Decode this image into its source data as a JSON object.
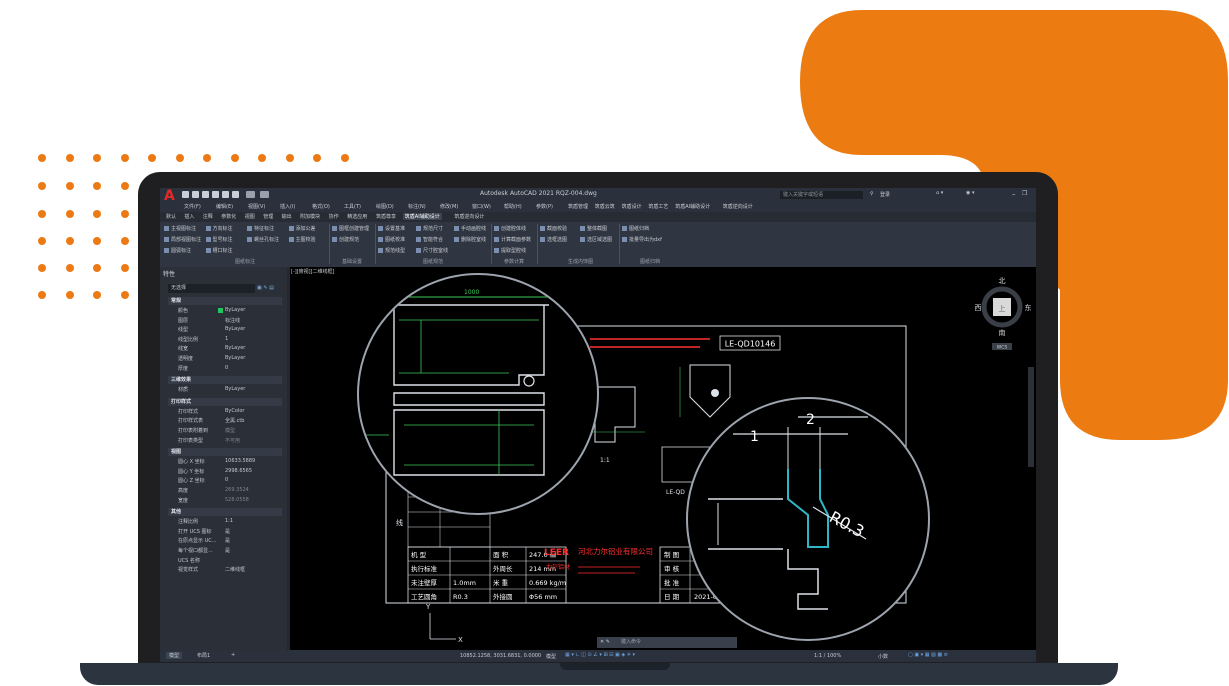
{
  "colors": {
    "accent": "#ec7a14",
    "laptop": "#1f1f22",
    "screen_bg": "#232831",
    "drawing_bg": "#000000",
    "line_white": "#dde2e8",
    "line_green": "#3ec85a",
    "line_red": "#ff3030",
    "line_cyan": "#2fb6c6"
  },
  "app": {
    "title": "Autodesk AutoCAD 2021   RQZ-004.dwg",
    "search_placeholder": "键入关键字或短语",
    "login_label": "登录",
    "quick_access_icons": [
      "new-icon",
      "open-icon",
      "save-icon",
      "saveas-icon",
      "print-icon",
      "plot-icon",
      "undo-icon",
      "redo-icon"
    ]
  },
  "menu": [
    "文件(F)",
    "编辑(E)",
    "视图(V)",
    "插入(I)",
    "格式(O)",
    "工具(T)",
    "绘图(D)",
    "标注(N)",
    "修改(M)",
    "窗口(W)",
    "帮助(H)",
    "参数(P)",
    "筑盾管理",
    "筑盾云筑",
    "筑盾设计",
    "筑盾工艺",
    "筑盾AI辅助设计",
    "筑盾逆向设计"
  ],
  "tabs": [
    "默认",
    "插入",
    "注释",
    "参数化",
    "视图",
    "管理",
    "输出",
    "附加模块",
    "协作",
    "精选应用",
    "筑盾尊享",
    "筑盾AI辅助设计",
    "筑盾逆向设计"
  ],
  "active_tab": "筑盾AI辅助设计",
  "ribbon": {
    "groups": [
      {
        "name": "图纸标注",
        "items": [
          "主视图标注",
          "方向标注",
          "特征标注",
          "添加公差",
          "局部视图标注",
          "型号标注",
          "螺丝孔标注",
          "主图校验",
          "圆弧标注",
          "槽口标注"
        ]
      },
      {
        "name": "基础设置",
        "items": [
          "图框创建管理",
          "创建规范"
        ]
      },
      {
        "name": "图纸规范",
        "items": [
          "设置基准",
          "规范尺寸",
          "手动画腔线",
          "图纸校准",
          "智能符合",
          "删除腔室线",
          "规范线型",
          "尺寸腔室线"
        ]
      },
      {
        "name": "参数计算",
        "items": [
          "创建腔体线",
          "计算截面参数",
          "提取型腔线"
        ]
      },
      {
        "name": "生成内饰图",
        "items": [
          "截面校验",
          "整体截图",
          "选框选图",
          "选区域选图"
        ]
      },
      {
        "name": "图纸归档",
        "items": [
          "图纸归档",
          "批量导出为dxf"
        ]
      }
    ]
  },
  "properties": {
    "title": "特性",
    "selection": "无选择",
    "sections": [
      {
        "name": "常规",
        "rows": [
          [
            "颜色",
            "ByLayer"
          ],
          [
            "图层",
            "标注线"
          ],
          [
            "线型",
            "ByLayer"
          ],
          [
            "线型比例",
            "1"
          ],
          [
            "线宽",
            "ByLayer"
          ],
          [
            "透明度",
            "ByLayer"
          ],
          [
            "厚度",
            "0"
          ]
        ]
      },
      {
        "name": "三维效果",
        "rows": [
          [
            "材质",
            "ByLayer"
          ]
        ]
      },
      {
        "name": "打印样式",
        "rows": [
          [
            "打印样式",
            "ByColor"
          ],
          [
            "打印样式表",
            "全黑.ctb"
          ],
          [
            "打印表附着到",
            "模型"
          ],
          [
            "打印表类型",
            "不可用"
          ]
        ]
      },
      {
        "name": "视图",
        "rows": [
          [
            "圆心 X 坐标",
            "10633.5889"
          ],
          [
            "圆心 Y 坐标",
            "2998.6565"
          ],
          [
            "圆心 Z 坐标",
            "0"
          ],
          [
            "高度",
            "269.3524"
          ],
          [
            "宽度",
            "528.0558"
          ]
        ]
      },
      {
        "name": "其他",
        "rows": [
          [
            "注释比例",
            "1:1"
          ],
          [
            "打开 UCS 图标",
            "是"
          ],
          [
            "在原点显示 UC...",
            "是"
          ],
          [
            "每个视口都显...",
            "是"
          ],
          [
            "UCS 名称",
            ""
          ],
          [
            "视觉样式",
            "二维线框"
          ]
        ]
      }
    ]
  },
  "canvas": {
    "view_label": "[-][俯视][二维线框]",
    "part_code": "LE-QD10146",
    "company": "河北力尔铝业有限公司",
    "logo_text": "LEER",
    "brand_small": "力尔铝材",
    "scale_label": "1:1",
    "side_char": "线",
    "label_le": "LE-QD",
    "table_rows": [
      [
        "机 型",
        "",
        "面 积",
        "247.0 ㎟"
      ],
      [
        "执行标准",
        "",
        "外周长",
        "214 mm"
      ],
      [
        "未注壁厚",
        "1.0mm",
        "米 重",
        "0.669 kg/m"
      ],
      [
        "工艺圆角",
        "R0.3",
        "外接圆",
        "Φ56 mm"
      ]
    ],
    "table_right": [
      [
        "制 图",
        ""
      ],
      [
        "审 核",
        ""
      ],
      [
        "批 准",
        ""
      ],
      [
        "日 期",
        "2021-03-22"
      ]
    ],
    "zoom_labels": {
      "dim1": "1",
      "dim2": "2",
      "radius": "R0.3"
    },
    "viewcube": {
      "north": "北",
      "south": "南",
      "east": "东",
      "west": "西",
      "top": "上",
      "wcs": "WCS"
    }
  },
  "status": {
    "tabs": [
      "模型",
      "布局1",
      "+"
    ],
    "coords": "10852.1258, 3031.6831, 0.0000",
    "mode": "模型",
    "scale": "1:1 / 100%",
    "decimal": "小数",
    "command_placeholder": "键入命令"
  }
}
